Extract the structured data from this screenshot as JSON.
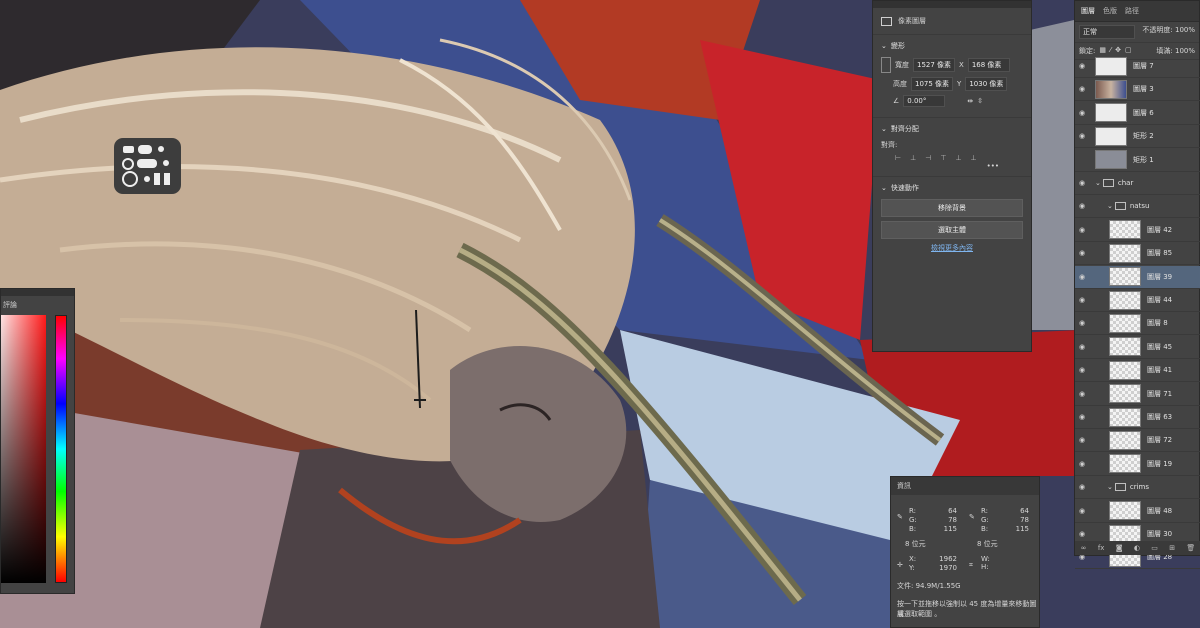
{
  "properties": {
    "title": "像素圖層",
    "transform": {
      "title": "變形",
      "width_label": "寬度",
      "width_value": "1527 像素",
      "x_label": "X",
      "x_value": "168 像素",
      "height_label": "高度",
      "height_value": "1075 像素",
      "y_label": "Y",
      "y_value": "1030 像素",
      "angle_value": "0.00°"
    },
    "align": {
      "title": "對齊分配",
      "label": "對齊:",
      "more": "•••"
    },
    "quick_actions": {
      "title": "快速動作",
      "remove_bg": "移除背景",
      "select_subject": "選取主體",
      "learn_more": "檢視更多內容"
    }
  },
  "layers": {
    "tabs": [
      "圖層",
      "色版",
      "路徑"
    ],
    "blend_mode": "正常",
    "opacity_label": "不透明度:",
    "opacity_value": "100%",
    "lock_label": "鎖定:",
    "fill_label": "填滿:",
    "fill_value": "100%",
    "items": [
      {
        "name": "圖層 7",
        "visible": true,
        "thumb": "plain"
      },
      {
        "name": "圖層 3",
        "visible": true,
        "thumb": "art"
      },
      {
        "name": "圖層 6",
        "visible": true,
        "thumb": "plain"
      },
      {
        "name": "矩形 2",
        "visible": true,
        "thumb": "plain"
      },
      {
        "name": "矩形 1",
        "visible": false,
        "thumb": "grey"
      },
      {
        "name": "char",
        "visible": true,
        "thumb": "folder"
      },
      {
        "name": "natsu",
        "visible": true,
        "thumb": "folder"
      },
      {
        "name": "圖層 42",
        "visible": true,
        "thumb": "check"
      },
      {
        "name": "圖層 85",
        "visible": true,
        "thumb": "check"
      },
      {
        "name": "圖層 39",
        "visible": true,
        "thumb": "check",
        "selected": true
      },
      {
        "name": "圖層 44",
        "visible": true,
        "thumb": "check"
      },
      {
        "name": "圖層 8",
        "visible": true,
        "thumb": "check"
      },
      {
        "name": "圖層 45",
        "visible": true,
        "thumb": "check"
      },
      {
        "name": "圖層 41",
        "visible": true,
        "thumb": "check"
      },
      {
        "name": "圖層 71",
        "visible": true,
        "thumb": "check"
      },
      {
        "name": "圖層 63",
        "visible": true,
        "thumb": "check"
      },
      {
        "name": "圖層 72",
        "visible": true,
        "thumb": "check"
      },
      {
        "name": "圖層 19",
        "visible": true,
        "thumb": "check"
      },
      {
        "name": "crims",
        "visible": true,
        "thumb": "folder"
      },
      {
        "name": "圖層 48",
        "visible": true,
        "thumb": "check"
      },
      {
        "name": "圖層 30",
        "visible": true,
        "thumb": "check"
      },
      {
        "name": "圖層 28",
        "visible": true,
        "thumb": "check"
      }
    ],
    "footer_icons": [
      "link-icon",
      "fx-icon",
      "mask-icon",
      "adjustment-icon",
      "folder-icon",
      "new-layer-icon",
      "trash-icon"
    ],
    "footer_fx": "fx"
  },
  "info": {
    "title": "資訊",
    "left": {
      "r_label": "R:",
      "r": "64",
      "g_label": "G:",
      "g": "78",
      "b_label": "B:",
      "b": "115"
    },
    "right": {
      "r_label": "R:",
      "r": "64",
      "g_label": "G:",
      "g": "78",
      "b_label": "B:",
      "b": "115"
    },
    "bits_left": "8 位元",
    "bits_right": "8 位元",
    "x_label": "X:",
    "x": "1962",
    "y_label": "Y:",
    "y": "1970",
    "w_label": "W:",
    "h_label": "H:",
    "doc": "文件: 94.9M/1.55G",
    "hint_line1": "按一下並拖移以強制以 45 度為增量來移動圖層",
    "hint_line2": "或選取範圍 。"
  },
  "color_panel": {
    "tab": "評論"
  },
  "colors": {
    "panel_bg": "#434343",
    "selected_layer": "#54667d",
    "link": "#7fb5ef",
    "sky_blue": "#3d4f8f",
    "red": "#c8232a"
  }
}
